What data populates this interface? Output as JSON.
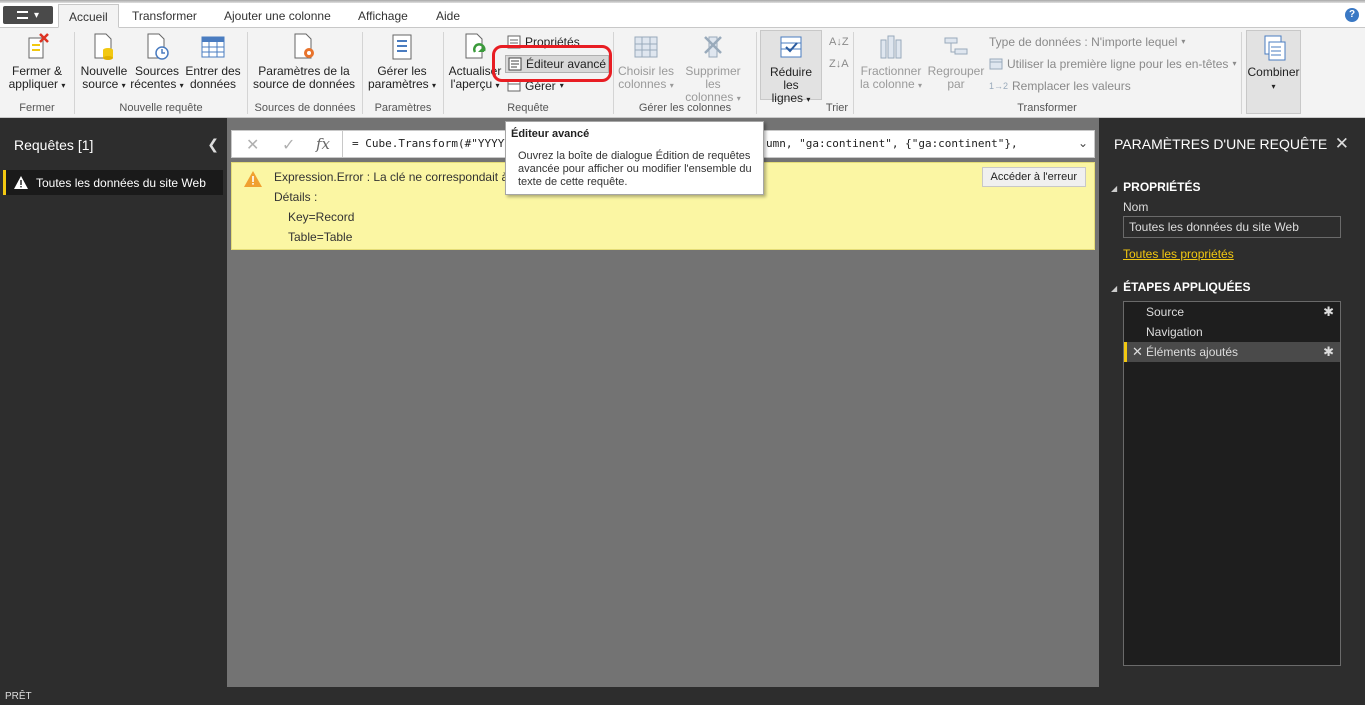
{
  "tabs": [
    "Accueil",
    "Transformer",
    "Ajouter une colonne",
    "Affichage",
    "Aide"
  ],
  "ribbon": {
    "close_apply": {
      "line1": "Fermer &",
      "line2": "appliquer"
    },
    "new_source": {
      "line1": "Nouvelle",
      "line2": "source"
    },
    "recent_sources": {
      "line1": "Sources",
      "line2": "récentes"
    },
    "enter_data": {
      "line1": "Entrer des",
      "line2": "données"
    },
    "data_source_settings": {
      "line1": "Paramètres de la",
      "line2": "source de données"
    },
    "manage_params": {
      "line1": "Gérer les",
      "line2": "paramètres"
    },
    "refresh_preview": {
      "line1": "Actualiser",
      "line2": "l'aperçu"
    },
    "properties": "Propriétés",
    "advanced_editor": "Éditeur avancé",
    "manage": "Gérer",
    "choose_columns": {
      "line1": "Choisir les",
      "line2": "colonnes"
    },
    "remove_columns": {
      "line1": "Supprimer les",
      "line2": "colonnes"
    },
    "reduce_rows": {
      "line1": "Réduire les",
      "line2": "lignes"
    },
    "split_column": {
      "line1": "Fractionner",
      "line2": "la colonne"
    },
    "group_by": {
      "line1": "Regrouper",
      "line2": "par"
    },
    "data_type": "Type de données : N'importe lequel",
    "first_row_headers": "Utiliser la première ligne pour les en-têtes",
    "replace_values": "Remplacer les valeurs",
    "combine": "Combiner",
    "groups": {
      "close": "Fermer",
      "new_query": "Nouvelle requête",
      "data_sources": "Sources de données",
      "params": "Paramètres",
      "query": "Requête",
      "manage_columns": "Gérer les colonnes",
      "sort": "Trier",
      "transform": "Transformer"
    }
  },
  "left": {
    "title": "Requêtes [1]",
    "query": "Toutes les données du site Web"
  },
  "formula": {
    "text": "= Cube.Transform(#\"YYYYY",
    "text_tail": "umn, \"ga:continent\", {\"ga:continent\"},"
  },
  "error": {
    "line1": "Expression.Error : La clé ne correspondait à",
    "line2": "Détails :",
    "line3": "Key=Record",
    "line4": "Table=Table",
    "goto": "Accéder à l'erreur"
  },
  "tooltip": {
    "title": "Éditeur avancé",
    "body": "Ouvrez la boîte de dialogue Édition de requêtes avancée pour afficher ou modifier l'ensemble du texte de cette requête."
  },
  "right": {
    "title": "PARAMÈTRES D'UNE REQUÊTE",
    "properties": "PROPRIÉTÉS",
    "name_label": "Nom",
    "name_value": "Toutes les données du site Web",
    "all_props": "Toutes les propriétés",
    "steps_title": "ÉTAPES APPLIQUÉES",
    "steps": [
      "Source",
      "Navigation",
      "Éléments ajoutés"
    ]
  },
  "status": "PRÊT"
}
